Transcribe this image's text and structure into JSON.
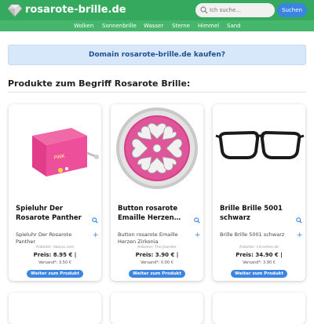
{
  "header": {
    "site_name": "rosarote-brille.de",
    "logo_icon": "gem-icon",
    "search": {
      "placeholder": "Ich suche...",
      "button_label": "Suchen",
      "icon": "search-icon"
    },
    "colors": {
      "bar": "#35a95e",
      "nav": "#46b66d",
      "accent": "#3b84e0"
    }
  },
  "nav": {
    "items": [
      {
        "label": "Wolken"
      },
      {
        "label": "Sonnenbrille"
      },
      {
        "label": "Wasser"
      },
      {
        "label": "Sterne"
      },
      {
        "label": "Himmel"
      },
      {
        "label": "Sand"
      }
    ]
  },
  "banner": {
    "text": "Domain rosarote-brille.de kaufen?"
  },
  "section": {
    "title": "Produkte zum Begriff Rosarote Brille:"
  },
  "products": [
    {
      "title": "Spieluhr Der Rosarote Panther",
      "description": "Spieluhr Der Rosarote Panther",
      "vendor": "Anbieter: daoroc.com",
      "price": "Preis: 8.95 € |",
      "shipping": "Versand*: 3.50 €",
      "button": "Weiter zum Produkt",
      "image_icon": "music-box-image"
    },
    {
      "title": "Button rosarote Emaille Herzen…",
      "description": "Button rosarote Emaille Herzen Zirkonia",
      "vendor": "Anbieter: The Jeweller",
      "price": "Preis: 3.90 € |",
      "shipping": "Versand*: 0.00 €",
      "button": "Weiter zum Produkt",
      "image_icon": "heart-button-image"
    },
    {
      "title": "Brille Brille 5001 schwarz",
      "description": "Brille Brille 5001 schwarz",
      "vendor": "Anbieter: LA-sehen.de",
      "price": "Preis: 34.90 € |",
      "shipping": "Versand*: 3.90 €",
      "button": "Weiter zum Produkt",
      "image_icon": "glasses-image"
    }
  ]
}
